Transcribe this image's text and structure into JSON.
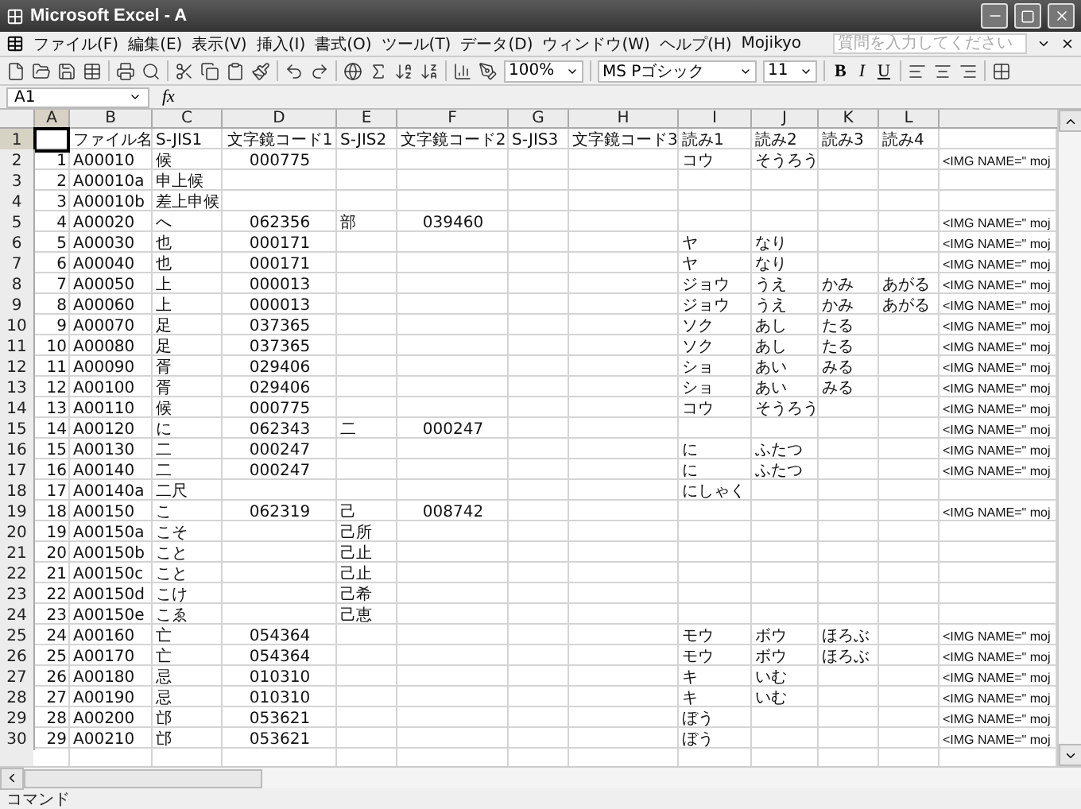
{
  "window": {
    "title": "Microsoft Excel - A"
  },
  "menu": [
    "ファイル(F)",
    "編集(E)",
    "表示(V)",
    "挿入(I)",
    "書式(O)",
    "ツール(T)",
    "データ(D)",
    "ウィンドウ(W)",
    "ヘルプ(H)",
    "Mojikyo"
  ],
  "help_search": {
    "placeholder": "質問を入力してください"
  },
  "toolbar": {
    "zoom": "100%",
    "font": "MS Pゴシック",
    "font_size": "11",
    "bold": "B",
    "italic": "I",
    "underline": "U"
  },
  "name_box": "A1",
  "formula_bar_label": "fx",
  "columns": [
    {
      "label": "A",
      "selected": true
    },
    {
      "label": "B",
      "selected": false
    },
    {
      "label": "C",
      "selected": false
    },
    {
      "label": "D",
      "selected": false
    },
    {
      "label": "E",
      "selected": false
    },
    {
      "label": "F",
      "selected": false
    },
    {
      "label": "G",
      "selected": false
    },
    {
      "label": "H",
      "selected": false
    },
    {
      "label": "I",
      "selected": false
    },
    {
      "label": "J",
      "selected": false
    },
    {
      "label": "K",
      "selected": false
    },
    {
      "label": "L",
      "selected": false
    }
  ],
  "rows": [
    {
      "header": "1",
      "selected": true,
      "cells": {
        "B": "ファイル名",
        "C": "S-JIS1",
        "D": "文字鏡コード1",
        "E": "S-JIS2",
        "F": "文字鏡コード2",
        "G": "S-JIS3",
        "H": "文字鏡コード3",
        "I": "読み1",
        "J": "読み2",
        "K": "読み3",
        "L": "読み4"
      }
    },
    {
      "header": "2",
      "selected": false,
      "cells": {
        "A": "1",
        "B": "A00010",
        "C": "候",
        "D": "000775",
        "I": "コウ",
        "J": "そうろう",
        "M": "<IMG NAME=\" moj"
      }
    },
    {
      "header": "3",
      "selected": false,
      "cells": {
        "A": "2",
        "B": "A00010a",
        "C": "申上候"
      }
    },
    {
      "header": "4",
      "selected": false,
      "cells": {
        "A": "3",
        "B": "A00010b",
        "C": "差上申候"
      }
    },
    {
      "header": "5",
      "selected": false,
      "cells": {
        "A": "4",
        "B": "A00020",
        "C": "へ",
        "D": "062356",
        "E": "部",
        "F": "039460",
        "M": "<IMG NAME=\" moj"
      }
    },
    {
      "header": "6",
      "selected": false,
      "cells": {
        "A": "5",
        "B": "A00030",
        "C": "也",
        "D": "000171",
        "I": "ヤ",
        "J": "なり",
        "M": "<IMG NAME=\" moj"
      }
    },
    {
      "header": "7",
      "selected": false,
      "cells": {
        "A": "6",
        "B": "A00040",
        "C": "也",
        "D": "000171",
        "I": "ヤ",
        "J": "なり",
        "M": "<IMG NAME=\" moj"
      }
    },
    {
      "header": "8",
      "selected": false,
      "cells": {
        "A": "7",
        "B": "A00050",
        "C": "上",
        "D": "000013",
        "I": "ジョウ",
        "J": "うえ",
        "K": "かみ",
        "L": "あがる",
        "M": "<IMG NAME=\" moj"
      }
    },
    {
      "header": "9",
      "selected": false,
      "cells": {
        "A": "8",
        "B": "A00060",
        "C": "上",
        "D": "000013",
        "I": "ジョウ",
        "J": "うえ",
        "K": "かみ",
        "L": "あがる",
        "M": "<IMG NAME=\" moj"
      }
    },
    {
      "header": "10",
      "selected": false,
      "cells": {
        "A": "9",
        "B": "A00070",
        "C": "足",
        "D": "037365",
        "I": "ソク",
        "J": "あし",
        "K": "たる",
        "M": "<IMG NAME=\" moj"
      }
    },
    {
      "header": "11",
      "selected": false,
      "cells": {
        "A": "10",
        "B": "A00080",
        "C": "足",
        "D": "037365",
        "I": "ソク",
        "J": "あし",
        "K": "たる",
        "M": "<IMG NAME=\" moj"
      }
    },
    {
      "header": "12",
      "selected": false,
      "cells": {
        "A": "11",
        "B": "A00090",
        "C": "胥",
        "D": "029406",
        "I": "ショ",
        "J": "あい",
        "K": "みる",
        "M": "<IMG NAME=\" moj"
      }
    },
    {
      "header": "13",
      "selected": false,
      "cells": {
        "A": "12",
        "B": "A00100",
        "C": "胥",
        "D": "029406",
        "I": "ショ",
        "J": "あい",
        "K": "みる",
        "M": "<IMG NAME=\" moj"
      }
    },
    {
      "header": "14",
      "selected": false,
      "cells": {
        "A": "13",
        "B": "A00110",
        "C": "候",
        "D": "000775",
        "I": "コウ",
        "J": "そうろう",
        "M": "<IMG NAME=\" moj"
      }
    },
    {
      "header": "15",
      "selected": false,
      "cells": {
        "A": "14",
        "B": "A00120",
        "C": "に",
        "D": "062343",
        "E": "二",
        "F": "000247",
        "M": "<IMG NAME=\" moj"
      }
    },
    {
      "header": "16",
      "selected": false,
      "cells": {
        "A": "15",
        "B": "A00130",
        "C": "二",
        "D": "000247",
        "I": "に",
        "J": "ふたつ",
        "M": "<IMG NAME=\" moj"
      }
    },
    {
      "header": "17",
      "selected": false,
      "cells": {
        "A": "16",
        "B": "A00140",
        "C": "二",
        "D": "000247",
        "I": "に",
        "J": "ふたつ",
        "M": "<IMG NAME=\" moj"
      }
    },
    {
      "header": "18",
      "selected": false,
      "cells": {
        "A": "17",
        "B": "A00140a",
        "C": "二尺",
        "I": "にしゃく"
      }
    },
    {
      "header": "19",
      "selected": false,
      "cells": {
        "A": "18",
        "B": "A00150",
        "C": "こ",
        "D": "062319",
        "E": "己",
        "F": "008742",
        "M": "<IMG NAME=\" moj"
      }
    },
    {
      "header": "20",
      "selected": false,
      "cells": {
        "A": "19",
        "B": "A00150a",
        "C": "こそ",
        "E": "己所"
      }
    },
    {
      "header": "21",
      "selected": false,
      "cells": {
        "A": "20",
        "B": "A00150b",
        "C": "こと",
        "E": "己止"
      }
    },
    {
      "header": "22",
      "selected": false,
      "cells": {
        "A": "21",
        "B": "A00150c",
        "C": "こと",
        "E": "己止"
      }
    },
    {
      "header": "23",
      "selected": false,
      "cells": {
        "A": "22",
        "B": "A00150d",
        "C": "こけ",
        "E": "己希"
      }
    },
    {
      "header": "24",
      "selected": false,
      "cells": {
        "A": "23",
        "B": "A00150e",
        "C": "こゑ",
        "E": "己恵"
      }
    },
    {
      "header": "25",
      "selected": false,
      "cells": {
        "A": "24",
        "B": "A00160",
        "C": "亡",
        "D": "054364",
        "I": "モウ",
        "J": "ボウ",
        "K": "ほろぶ",
        "M": "<IMG NAME=\" moj"
      }
    },
    {
      "header": "26",
      "selected": false,
      "cells": {
        "A": "25",
        "B": "A00170",
        "C": "亡",
        "D": "054364",
        "I": "モウ",
        "J": "ボウ",
        "K": "ほろぶ",
        "M": "<IMG NAME=\" moj"
      }
    },
    {
      "header": "27",
      "selected": false,
      "cells": {
        "A": "26",
        "B": "A00180",
        "C": "忌",
        "D": "010310",
        "I": "キ",
        "J": "いむ",
        "M": "<IMG NAME=\" moj"
      }
    },
    {
      "header": "28",
      "selected": false,
      "cells": {
        "A": "27",
        "B": "A00190",
        "C": "忌",
        "D": "010310",
        "I": "キ",
        "J": "いむ",
        "M": "<IMG NAME=\" moj"
      }
    },
    {
      "header": "29",
      "selected": false,
      "cells": {
        "A": "28",
        "B": "A00200",
        "C": "邙",
        "D": "053621",
        "I": "ぼう",
        "M": "<IMG NAME=\" moj"
      }
    },
    {
      "header": "30",
      "selected": false,
      "cells": {
        "A": "29",
        "B": "A00210",
        "C": "邙",
        "D": "053621",
        "I": "ぼう",
        "M": "<IMG NAME=\" moj"
      }
    }
  ],
  "status_bar": "コマンド"
}
